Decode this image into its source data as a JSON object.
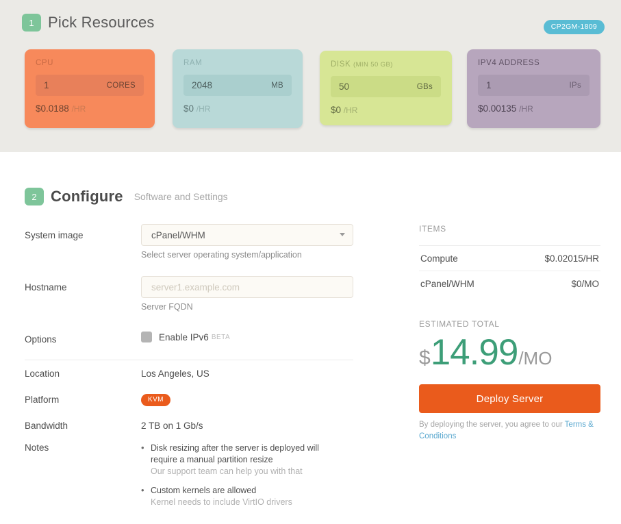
{
  "step1": {
    "number": "1",
    "title": "Pick Resources",
    "plan_badge": "CP2GM-1809",
    "resources": [
      {
        "key": "cpu",
        "label": "CPU",
        "label_note": "",
        "value": "1",
        "unit": "CORES",
        "price": "$0.0188",
        "price_per": "/HR",
        "color": "#f7895b"
      },
      {
        "key": "ram",
        "label": "RAM",
        "label_note": "",
        "value": "2048",
        "unit": "MB",
        "price": "$0",
        "price_per": "/HR",
        "color": "#b9d9d8"
      },
      {
        "key": "disk",
        "label": "DISK",
        "label_note": "(MIN 50 GB)",
        "value": "50",
        "unit": "GBs",
        "price": "$0",
        "price_per": "/HR",
        "color": "#d7e695"
      },
      {
        "key": "ipv4",
        "label": "IPV4 ADDRESS",
        "label_note": "",
        "value": "1",
        "unit": "IPs",
        "price": "$0.00135",
        "price_per": "/HR",
        "color": "#b7a6bd"
      }
    ]
  },
  "step2": {
    "number": "2",
    "title": "Configure",
    "subtitle": "Software and Settings",
    "system_image": {
      "label": "System image",
      "value": "cPanel/WHM",
      "helper": "Select server operating system/application"
    },
    "hostname": {
      "label": "Hostname",
      "value": "",
      "placeholder": "server1.example.com",
      "helper": "Server FQDN"
    },
    "options": {
      "label": "Options",
      "ipv6_label": "Enable IPv6",
      "ipv6_beta": "BETA",
      "ipv6_checked": false
    },
    "location": {
      "label": "Location",
      "value": "Los Angeles, US"
    },
    "platform": {
      "label": "Platform",
      "value": "KVM"
    },
    "bandwidth": {
      "label": "Bandwidth",
      "value": "2 TB on 1 Gb/s"
    },
    "notes": {
      "label": "Notes",
      "items": [
        {
          "text": "Disk resizing after the server is deployed will require a manual partition resize",
          "sub": "Our support team can help you with that"
        },
        {
          "text": "Custom kernels are allowed",
          "sub": "Kernel needs to include VirtIO drivers"
        }
      ]
    }
  },
  "summary": {
    "items_heading": "ITEMS",
    "items": [
      {
        "name": "Compute",
        "price": "$0.02015/HR"
      },
      {
        "name": "cPanel/WHM",
        "price": "$0/MO"
      }
    ],
    "total_heading": "ESTIMATED TOTAL",
    "price": {
      "currency": "$",
      "amount": "14.99",
      "period": "/MO"
    },
    "deploy_label": "Deploy Server",
    "terms_prefix": "By deploying the server, you agree to our ",
    "terms_link": "Terms & Conditions"
  },
  "colors": {
    "accent_green": "#3d9e78",
    "accent_orange": "#ea5b1c",
    "step_badge": "#7ec59a",
    "plan_badge": "#59bcd4",
    "band_bg": "#ebeae6",
    "link": "#5aa8cf"
  }
}
